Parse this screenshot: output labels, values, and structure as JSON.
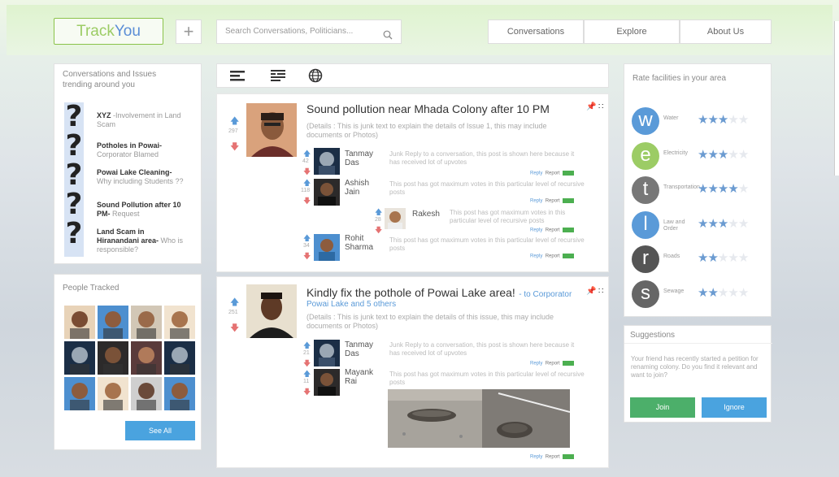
{
  "header": {
    "logo_a": "Track",
    "logo_b": "You",
    "add_label": "+",
    "search_placeholder": "Search Conversations, Politicians...",
    "nav": [
      "Conversations",
      "Explore",
      "About Us"
    ]
  },
  "trending": {
    "title": "Conversations and Issues trending around you",
    "items": [
      {
        "bold": "XYZ",
        "sub": " -Involvement in Land Scam"
      },
      {
        "bold": "Potholes in Powai-",
        "sub": " Corporator Blamed"
      },
      {
        "bold": "Powai Lake Cleaning-",
        "sub": " Why including Students ??"
      },
      {
        "bold": "Sound Pollution after 10 PM-",
        "sub": " Request"
      },
      {
        "bold": "Land Scam in Hiranandani area-",
        "sub": " Who is responsible?"
      }
    ]
  },
  "people": {
    "title": "People Tracked",
    "see_all": "See All"
  },
  "toolbar": {
    "icons": [
      "list-icon",
      "compact-list-icon",
      "globe-icon"
    ]
  },
  "posts": [
    {
      "title": "Sound pollution near Mhada Colony after 10 PM",
      "votes": "297",
      "tag": "",
      "tagline": "",
      "details": "(Details : This is junk text to explain the details of Issue 1, this may include documents or Photos)",
      "replies": [
        {
          "name": "Tanmay Das",
          "votes": "42",
          "text": "Junk Reply to a conversation, this post is shown here because it has received lot of upvotes"
        },
        {
          "name": "Ashish Jain",
          "votes": "118",
          "text": "This post has got maximum votes in this particular level of recursive posts"
        },
        {
          "name": "Rakesh",
          "votes": "28",
          "text": "This post has got maximum votes in this particular level of recursive posts"
        },
        {
          "name": "Rohit Sharma",
          "votes": "34",
          "text": "This post has got maximum votes in this particular level of recursive posts"
        }
      ]
    },
    {
      "title": "Kindly fix the pothole of Powai Lake area!",
      "votes": "251",
      "tag": "- to Corporator",
      "tagline": "Powai Lake and 5 others",
      "details": "(Details : This is junk text to explain the details of this issue, this may include documents or Photos)",
      "replies": [
        {
          "name": "Tanmay Das",
          "votes": "21",
          "text": "Junk Reply to a conversation, this post is shown here because it has received lot of upvotes"
        },
        {
          "name": "Mayank Rai",
          "votes": "11",
          "text": "This post has got maximum votes in this particular level of recursive posts"
        }
      ]
    }
  ],
  "actions": {
    "reply": "Reply",
    "report": "Report"
  },
  "rate": {
    "title": "Rate facilities in your area",
    "items": [
      {
        "letter": "w",
        "label": "Water",
        "stars": 3,
        "color": "#5a9ad8"
      },
      {
        "letter": "e",
        "label": "Electricity",
        "stars": 3,
        "color": "#9ccc65"
      },
      {
        "letter": "t",
        "label": "Transportation",
        "stars": 4,
        "color": "#777777"
      },
      {
        "letter": "l",
        "label": "Law and Order",
        "stars": 3,
        "color": "#5a9ad8"
      },
      {
        "letter": "r",
        "label": "Roads",
        "stars": 2,
        "color": "#555555"
      },
      {
        "letter": "s",
        "label": "Sewage",
        "stars": 2,
        "color": "#666666"
      }
    ]
  },
  "suggestions": {
    "title": "Suggestions",
    "text": "Your friend has recently started a petition for renaming colony. Do you find it relevant and want to join?",
    "join": "Join",
    "ignore": "Ignore"
  }
}
